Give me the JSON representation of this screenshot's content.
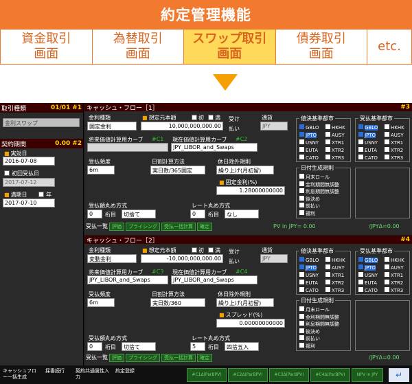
{
  "banner": {
    "title": "約定管理機能"
  },
  "tabs": [
    {
      "l1": "資金取引",
      "l2": "画面"
    },
    {
      "l1": "為替取引",
      "l2": "画面"
    },
    {
      "l1": "スワップ取引",
      "l2": "画面"
    },
    {
      "l1": "債券取引",
      "l2": "画面"
    },
    {
      "l1": "etc.",
      "l2": ""
    }
  ],
  "left": {
    "trade_type_title": "取引種類",
    "trade_type_count": "01/01",
    "trade_type_num": "#1",
    "trade_type_value": "金利スワップ",
    "contract_title": "契約期間",
    "contract_amount": "0.00",
    "contract_num": "#2",
    "effective_label": "実効日",
    "effective_value": "2016-07-08",
    "first_recv_label": "初回受払日",
    "first_recv_value": "2017-07-12",
    "maturity_label": "満期日",
    "year_label": "年",
    "maturity_value": "2017-07-10"
  },
  "panel1": {
    "title": "キャッシュ・フロー［1］",
    "num": "#3",
    "rate_type_label": "金利種類",
    "rate_type": "固定金利",
    "notional_label": "想定元本額",
    "notional": "10,000,000,000.00",
    "first_label": "初",
    "last_label": "満",
    "recv_label": "受け",
    "pay_label": "払い",
    "ccy_label": "通貨",
    "ccy": "JPY",
    "future_curve_label": "将来価値計算用カーブ",
    "future_curve_code": "#C1",
    "pv_curve_label": "現在価値計算用カーブ",
    "pv_curve_code": "#C2",
    "pv_curve": "JPY_LIBOR_and_Swaps",
    "freq_label": "受払頻度",
    "freq": "6m",
    "daycount_label": "日割計算方法",
    "daycount": "実日数/365固定",
    "holiday_label": "休日除外規則",
    "holiday": "繰り上げ(月初留)",
    "fixed_rate_label": "固定金利(%)",
    "fixed_rate": "1.28000000000",
    "round_label": "受払額丸め方式",
    "round_digits": "0",
    "round_unit": "桁目",
    "round_mode": "切捨て",
    "rate_round_label": "レート丸め方式",
    "rate_round_digits": "0",
    "rate_round_unit": "桁目",
    "rate_round_mode": "なし",
    "list_btn": "受払一覧",
    "btn_calc": "評価",
    "btn_pricing": "プライシング",
    "btn_bulk": "受払一括計算",
    "btn_conf": "確定",
    "pv_text": "PV in JPY= 0.00",
    "jpy_delta": "/JPYΔ=0.00"
  },
  "panel2": {
    "title": "キャッシュ・フロー［2］",
    "num": "#4",
    "rate_type": "変動金利",
    "notional": "-10,000,000,000.00",
    "future_curve_code": "#C3",
    "future_curve": "JPY_LIBOR_and_Swaps",
    "pv_curve_code": "#C4",
    "pv_curve": "JPY_LIBOR_and_Swaps",
    "freq": "6m",
    "daycount": "実日数/360",
    "holiday": "繰り上げ(月初留)",
    "spread_label": "スプレッド(%)",
    "spread": "0.00000000000",
    "round_digits": "0",
    "round_mode": "切捨て",
    "rate_round_digits": "5",
    "rate_round_mode": "四捨五入"
  },
  "settle": {
    "title": "値決基準都市",
    "recv_title": "受払基準都市",
    "cities_left": [
      "GBLO",
      "JPTO",
      "USNY",
      "EUTA",
      "CATO"
    ],
    "cities_right": [
      "HKHK",
      "AUSY",
      "XTR1",
      "XTR2",
      "XTR3"
    ]
  },
  "dategen": {
    "title": "日付生成規則",
    "items": [
      "月末ロール",
      "金利期間無調整",
      "利息期間無調整",
      "後決め",
      "前払い",
      "複利"
    ]
  },
  "footer": {
    "cf_btn": "キャッシュフロー一括生成",
    "fx_btn": "採番続行",
    "attr_btn": "契約共通属性入力",
    "save_btn": "約定登録",
    "stat1": "#C1Δ(ParBPV)",
    "stat2": "#C2Δ(ParBPV)",
    "stat3": "#C3Δ(ParBPV)",
    "stat4": "#C4Δ(ParBPV)",
    "npv": "NPV in JPY"
  },
  "colors": {
    "accent": "#f27a2e",
    "active_tab": "#ffd95a",
    "arrow": "#f5a000"
  }
}
